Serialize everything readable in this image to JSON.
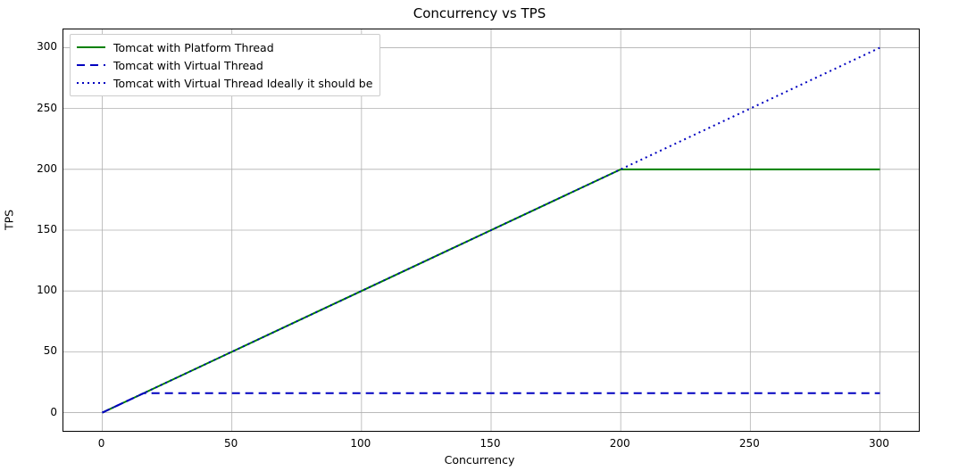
{
  "chart_data": {
    "type": "line",
    "title": "Concurrency vs TPS",
    "xlabel": "Concurrency",
    "ylabel": "TPS",
    "xlim": [
      -15,
      315
    ],
    "ylim": [
      -15,
      315
    ],
    "x_ticks": [
      0,
      50,
      100,
      150,
      200,
      250,
      300
    ],
    "y_ticks": [
      0,
      50,
      100,
      150,
      200,
      250,
      300
    ],
    "grid": true,
    "legend_position": "upper left",
    "series": [
      {
        "name": "Tomcat with Platform Thread",
        "color": "#008000",
        "style": "solid",
        "x": [
          0,
          16,
          50,
          100,
          150,
          200,
          250,
          300
        ],
        "values": [
          0,
          16,
          50,
          100,
          150,
          200,
          200,
          200
        ]
      },
      {
        "name": "Tomcat with Virtual Thread",
        "color": "#0000c0",
        "style": "dashed",
        "x": [
          0,
          16,
          50,
          100,
          150,
          200,
          250,
          300
        ],
        "values": [
          0,
          16,
          16,
          16,
          16,
          16,
          16,
          16
        ]
      },
      {
        "name": "Tomcat with Virtual Thread Ideally it should be",
        "color": "#0000c0",
        "style": "dotted",
        "x": [
          0,
          16,
          50,
          100,
          150,
          200,
          250,
          300
        ],
        "values": [
          0,
          16,
          50,
          100,
          150,
          200,
          250,
          300
        ]
      }
    ]
  }
}
